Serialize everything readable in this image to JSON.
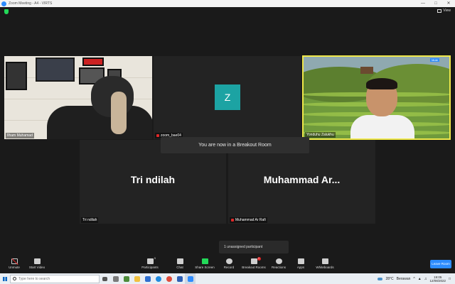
{
  "window": {
    "title": "Zoom Meeting - A4 - VIRTS",
    "controls": [
      "—",
      "□",
      "✕"
    ]
  },
  "topbar": {
    "view_label": "View"
  },
  "participants": [
    {
      "name": "Ilham Muhamad"
    },
    {
      "name": "zoom_bae04",
      "avatar_letter": "Z"
    },
    {
      "name": "Yonduhu Zalukhu",
      "tag": "Mute"
    },
    {
      "name": "Tri ndilah",
      "display": "Tri ndilah"
    },
    {
      "name": "Muhammad Ar Rafi",
      "display": "Muhammad  Ar..."
    }
  ],
  "banner": {
    "text": "You are now in a Breakout Room"
  },
  "unassigned": {
    "text": "1 unassigned participant"
  },
  "toolbar": {
    "unmute": "Unmute",
    "start_video": "Start Video",
    "participants": "Participants",
    "participants_count": "5",
    "chat": "Chat",
    "share_screen": "Share Screen",
    "record": "Record",
    "breakout_rooms": "Breakout Rooms",
    "breakout_badge": "1",
    "reactions": "Reactions",
    "apps": "Apps",
    "whiteboards": "Whiteboards",
    "leave_room": "Leave Room"
  },
  "taskbar": {
    "search_placeholder": "Type here to search",
    "weather_temp": "28°C",
    "weather_text": "Berawan",
    "time": "19:05",
    "date": "12/08/2022"
  },
  "colors": {
    "accent": "#2d8cff",
    "active_speaker_border": "#f0e84a",
    "avatar_bg": "#1ca3a3",
    "share_green": "#23d959",
    "mute_red": "#e02828"
  }
}
